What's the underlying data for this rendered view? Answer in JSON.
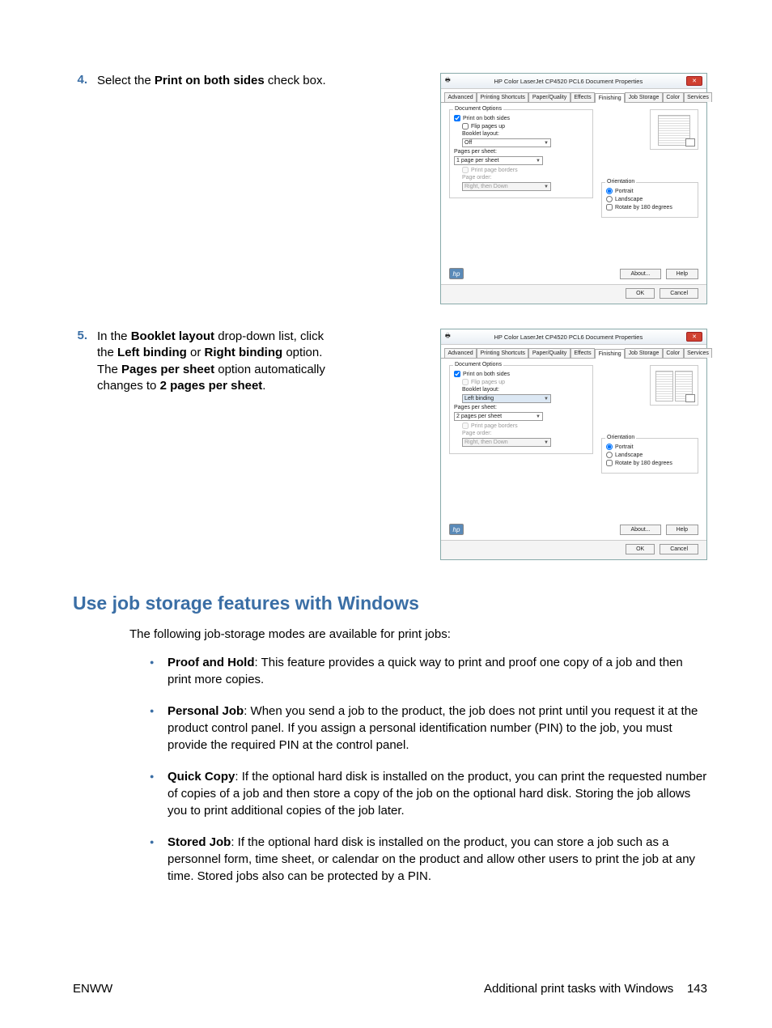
{
  "step4": {
    "num": "4.",
    "text_pre": "Select the ",
    "text_bold": "Print on both sides",
    "text_post": " check box."
  },
  "step5": {
    "num": "5.",
    "p1_a": "In the ",
    "p1_b": "Booklet layout",
    "p1_c": " drop-down list, click the ",
    "p1_d": "Left binding",
    "p1_e": " or ",
    "p1_f": "Right binding",
    "p1_g": " option. The ",
    "p1_h": "Pages per sheet",
    "p1_i": " option automatically changes to ",
    "p1_j": "2 pages per sheet",
    "p1_k": "."
  },
  "dialog": {
    "title": "HP Color LaserJet CP4520 PCL6 Document Properties",
    "close": "✕",
    "tabs": [
      "Advanced",
      "Printing Shortcuts",
      "Paper/Quality",
      "Effects",
      "Finishing",
      "Job Storage",
      "Color",
      "Services"
    ],
    "active_tab": "Finishing",
    "group": "Document Options",
    "print_both": "Print on both sides",
    "flip": "Flip pages up",
    "booklet": "Booklet layout:",
    "booklet_off": "Off",
    "booklet_left": "Left binding",
    "pps": "Pages per sheet:",
    "pps1": "1 page per sheet",
    "pps2": "2 pages per sheet",
    "borders": "Print page borders",
    "pageorder": "Page order:",
    "pageorder_val": "Right, then Down",
    "orientation": "Orientation",
    "portrait": "Portrait",
    "landscape": "Landscape",
    "rotate": "Rotate by 180 degrees",
    "about": "About...",
    "help": "Help",
    "ok": "OK",
    "cancel": "Cancel",
    "hp": "hp"
  },
  "section": {
    "heading": "Use job storage features with Windows",
    "intro": "The following job-storage modes are available for print jobs:",
    "b1_t": "Proof and Hold",
    "b1": ": This feature provides a quick way to print and proof one copy of a job and then print more copies.",
    "b2_t": "Personal Job",
    "b2": ": When you send a job to the product, the job does not print until you request it at the product control panel. If you assign a personal identification number (PIN) to the job, you must provide the required PIN at the control panel.",
    "b3_t": "Quick Copy",
    "b3": ": If the optional hard disk is installed on the product, you can print the requested number of copies of a job and then store a copy of the job on the optional hard disk. Storing the job allows you to print additional copies of the job later.",
    "b4_t": "Stored Job",
    "b4": ": If the optional hard disk is installed on the product, you can store a job such as a personnel form, time sheet, or calendar on the product and allow other users to print the job at any time. Stored jobs also can be protected by a PIN."
  },
  "footer": {
    "left": "ENWW",
    "right_text": "Additional print tasks with Windows",
    "page": "143"
  }
}
